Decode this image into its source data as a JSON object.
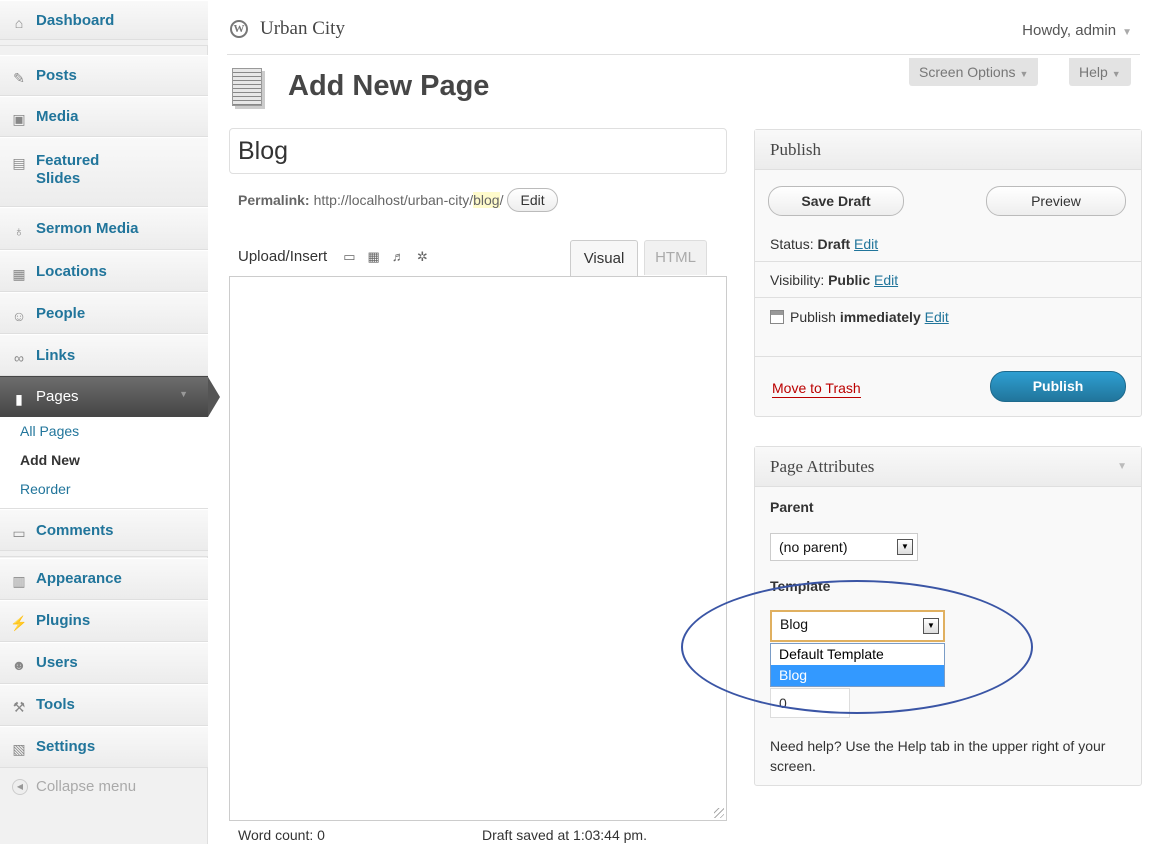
{
  "sidebar": {
    "items": [
      {
        "label": "Dashboard",
        "icon": "home-icon",
        "glyph": "⌂"
      },
      {
        "label": "Posts",
        "icon": "pushpin-icon",
        "glyph": "✎"
      },
      {
        "label": "Media",
        "icon": "camera-icon",
        "glyph": "▣"
      },
      {
        "label": "Featured",
        "label2": "Slides",
        "icon": "slides-icon",
        "glyph": "▤"
      },
      {
        "label": "Sermon Media",
        "icon": "microphone-icon",
        "glyph": "♁"
      },
      {
        "label": "Locations",
        "icon": "map-icon",
        "glyph": "▦"
      },
      {
        "label": "People",
        "icon": "person-icon",
        "glyph": "☺"
      },
      {
        "label": "Links",
        "icon": "link-icon",
        "glyph": "∞"
      },
      {
        "label": "Pages",
        "icon": "pages-icon",
        "glyph": "▮"
      },
      {
        "label": "Comments",
        "icon": "comment-icon",
        "glyph": "▭"
      },
      {
        "label": "Appearance",
        "icon": "appearance-icon",
        "glyph": "▥"
      },
      {
        "label": "Plugins",
        "icon": "plug-icon",
        "glyph": "⚡"
      },
      {
        "label": "Users",
        "icon": "users-icon",
        "glyph": "☻"
      },
      {
        "label": "Tools",
        "icon": "tools-icon",
        "glyph": "⚒"
      },
      {
        "label": "Settings",
        "icon": "settings-icon",
        "glyph": "▧"
      }
    ],
    "submenu": [
      "All Pages",
      "Add New",
      "Reorder"
    ],
    "collapse": "Collapse menu"
  },
  "header": {
    "site_title": "Urban City",
    "howdy": "Howdy, admin",
    "screen_options": "Screen Options",
    "help": "Help"
  },
  "page": {
    "title": "Add New Page",
    "post_title": "Blog",
    "permalink_label": "Permalink:",
    "permalink_base": "http://localhost/urban-city/",
    "permalink_slug": "blog",
    "permalink_trail": "/",
    "edit_button": "Edit"
  },
  "editor": {
    "upload_insert": "Upload/Insert",
    "tab_visual": "Visual",
    "tab_html": "HTML",
    "word_count": "Word count: 0",
    "draft_saved": "Draft saved at 1:03:44 pm."
  },
  "publish": {
    "heading": "Publish",
    "save_draft": "Save Draft",
    "preview": "Preview",
    "status_label": "Status:",
    "status_value": "Draft",
    "visibility_label": "Visibility:",
    "visibility_value": "Public",
    "publish_label": "Publish",
    "publish_value": "immediately",
    "edit": "Edit",
    "trash": "Move to Trash",
    "publish_button": "Publish"
  },
  "attributes": {
    "heading": "Page Attributes",
    "parent_label": "Parent",
    "parent_value": "(no parent)",
    "template_label": "Template",
    "template_value": "Blog",
    "template_options": [
      "Default Template",
      "Blog"
    ],
    "order_value": "0",
    "help_text": "Need help? Use the Help tab in the upper right of your screen."
  },
  "colors": {
    "link": "#21759b",
    "publish_button": "#21759b",
    "trash": "#bb0000",
    "annotation": "#3a55a5"
  }
}
